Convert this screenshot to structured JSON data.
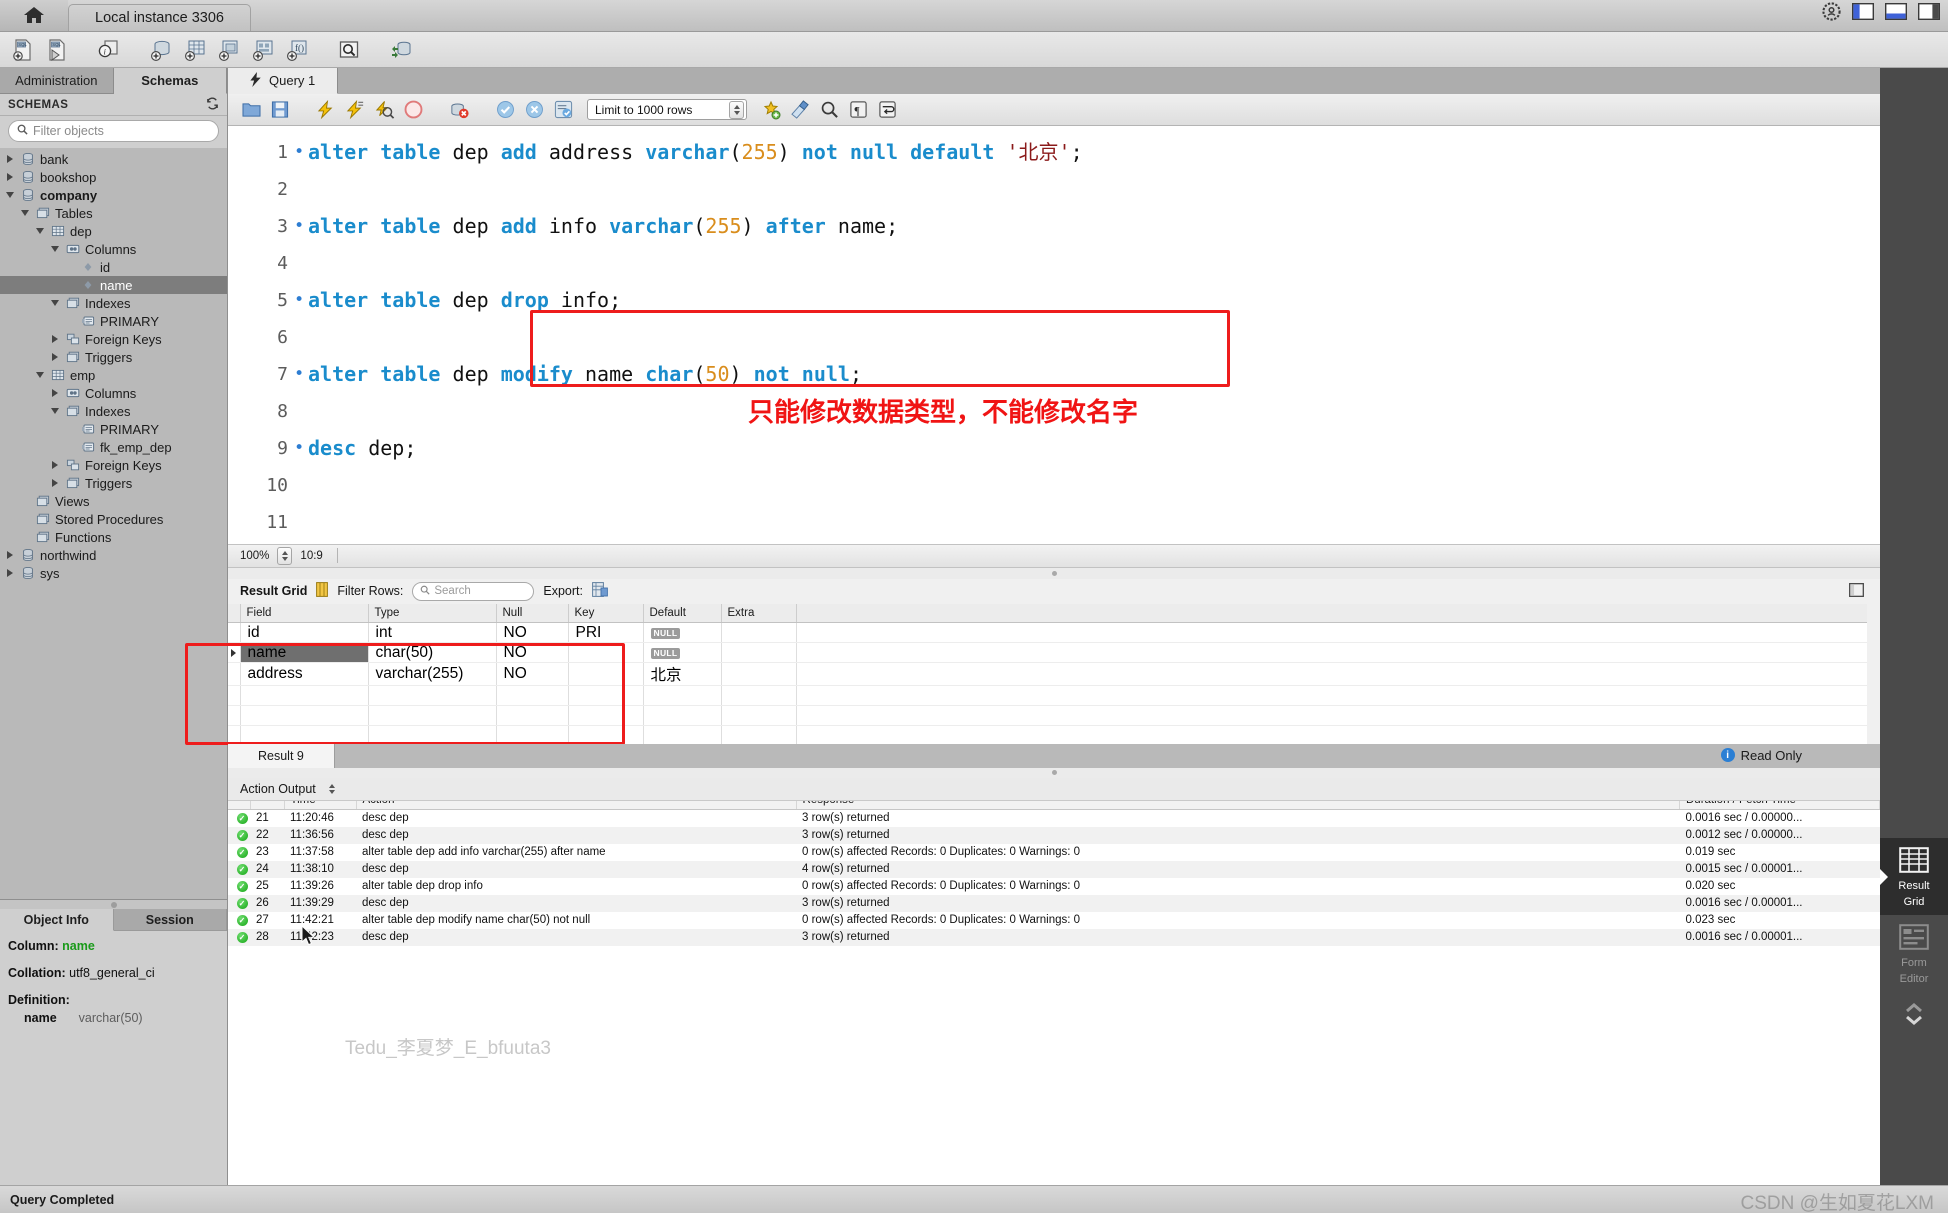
{
  "window": {
    "instance_tab": "Local instance 3306",
    "home_icon": "home-icon"
  },
  "top_right_icons": [
    "shield-gear-icon",
    "toggle-sidebar-icon",
    "toggle-output-icon",
    "toggle-secondary-sidebar-icon"
  ],
  "main_toolbar_icons": [
    "new-sql-tab-icon",
    "open-sql-script-icon",
    "sql-info-icon",
    "new-schema-icon",
    "new-table-icon",
    "new-view-icon",
    "new-stored-procedure-icon",
    "new-function-icon",
    "inspect-table-icon",
    "reconnect-server-icon"
  ],
  "sidebar": {
    "tabs": [
      {
        "label": "Administration",
        "active": false
      },
      {
        "label": "Schemas",
        "active": true
      }
    ],
    "schemas_header": "SCHEMAS",
    "refresh_icon": "refresh-icon",
    "filter": {
      "placeholder": "Filter objects",
      "value": "",
      "icon": "search-icon"
    },
    "tree": [
      {
        "label": "bank",
        "depth": 0,
        "state": "collapsed",
        "icon": "database-icon",
        "selected": false,
        "bold": false
      },
      {
        "label": "bookshop",
        "depth": 0,
        "state": "collapsed",
        "icon": "database-icon",
        "selected": false,
        "bold": false
      },
      {
        "label": "company",
        "depth": 0,
        "state": "expanded",
        "icon": "database-icon",
        "selected": false,
        "bold": true
      },
      {
        "label": "Tables",
        "depth": 1,
        "state": "expanded",
        "icon": "folder-icon",
        "selected": false,
        "bold": false
      },
      {
        "label": "dep",
        "depth": 2,
        "state": "expanded",
        "icon": "table-icon",
        "selected": false,
        "bold": false
      },
      {
        "label": "Columns",
        "depth": 3,
        "state": "expanded",
        "icon": "columns-icon",
        "selected": false,
        "bold": false
      },
      {
        "label": "id",
        "depth": 4,
        "state": "leaf",
        "icon": "column-icon",
        "selected": false,
        "bold": false
      },
      {
        "label": "name",
        "depth": 4,
        "state": "leaf",
        "icon": "column-icon",
        "selected": true,
        "bold": false
      },
      {
        "label": "Indexes",
        "depth": 3,
        "state": "expanded",
        "icon": "folder-icon",
        "selected": false,
        "bold": false
      },
      {
        "label": "PRIMARY",
        "depth": 4,
        "state": "leaf",
        "icon": "index-icon",
        "selected": false,
        "bold": false
      },
      {
        "label": "Foreign Keys",
        "depth": 3,
        "state": "collapsed",
        "icon": "fk-icon",
        "selected": false,
        "bold": false
      },
      {
        "label": "Triggers",
        "depth": 3,
        "state": "collapsed",
        "icon": "folder-icon",
        "selected": false,
        "bold": false
      },
      {
        "label": "emp",
        "depth": 2,
        "state": "expanded",
        "icon": "table-icon",
        "selected": false,
        "bold": false
      },
      {
        "label": "Columns",
        "depth": 3,
        "state": "collapsed",
        "icon": "columns-icon",
        "selected": false,
        "bold": false
      },
      {
        "label": "Indexes",
        "depth": 3,
        "state": "expanded",
        "icon": "folder-icon",
        "selected": false,
        "bold": false
      },
      {
        "label": "PRIMARY",
        "depth": 4,
        "state": "leaf",
        "icon": "index-icon",
        "selected": false,
        "bold": false
      },
      {
        "label": "fk_emp_dep",
        "depth": 4,
        "state": "leaf",
        "icon": "index-icon",
        "selected": false,
        "bold": false
      },
      {
        "label": "Foreign Keys",
        "depth": 3,
        "state": "collapsed",
        "icon": "fk-icon",
        "selected": false,
        "bold": false
      },
      {
        "label": "Triggers",
        "depth": 3,
        "state": "collapsed",
        "icon": "folder-icon",
        "selected": false,
        "bold": false
      },
      {
        "label": "Views",
        "depth": 1,
        "state": "leaf",
        "icon": "folder-icon",
        "selected": false,
        "bold": false
      },
      {
        "label": "Stored Procedures",
        "depth": 1,
        "state": "leaf",
        "icon": "folder-icon",
        "selected": false,
        "bold": false
      },
      {
        "label": "Functions",
        "depth": 1,
        "state": "leaf",
        "icon": "folder-icon",
        "selected": false,
        "bold": false
      },
      {
        "label": "northwind",
        "depth": 0,
        "state": "collapsed",
        "icon": "database-icon",
        "selected": false,
        "bold": false
      },
      {
        "label": "sys",
        "depth": 0,
        "state": "collapsed",
        "icon": "database-icon",
        "selected": false,
        "bold": false
      }
    ]
  },
  "object_info": {
    "tabs": [
      {
        "label": "Object Info",
        "active": true
      },
      {
        "label": "Session",
        "active": false
      }
    ],
    "column_key": "Column:",
    "column_value": "name",
    "collation_key": "Collation:",
    "collation_value": "utf8_general_ci",
    "definition_key": "Definition:",
    "definition_name": "name",
    "definition_type": "varchar(50)"
  },
  "query_tab": {
    "label": "Query 1",
    "icon": "lightning-icon"
  },
  "query_toolbar": {
    "icons": [
      "open-file-icon",
      "save-file-icon",
      "execute-icon",
      "execute-current-icon",
      "explain-icon",
      "stop-icon",
      "stop-on-error-icon",
      "commit-icon",
      "rollback-icon",
      "autocommit-icon"
    ],
    "limit_select": "Limit to 1000 rows",
    "trailing_icons": [
      "beautify-icon",
      "clear-context-icon",
      "find-icon",
      "invisible-chars-icon",
      "wrap-lines-icon"
    ]
  },
  "editor": {
    "lines": [
      {
        "n": "1",
        "bullet": true,
        "tokens": [
          {
            "t": "kw",
            "v": "alter"
          },
          {
            "t": "pln",
            "v": " "
          },
          {
            "t": "kw",
            "v": "table"
          },
          {
            "t": "pln",
            "v": " dep "
          },
          {
            "t": "kw",
            "v": "add"
          },
          {
            "t": "pln",
            "v": " address "
          },
          {
            "t": "kw",
            "v": "varchar"
          },
          {
            "t": "pln",
            "v": "("
          },
          {
            "t": "num",
            "v": "255"
          },
          {
            "t": "pln",
            "v": ") "
          },
          {
            "t": "kw",
            "v": "not null default"
          },
          {
            "t": "pln",
            "v": " "
          },
          {
            "t": "str",
            "v": "'北京'"
          },
          {
            "t": "pln",
            "v": ";"
          }
        ]
      },
      {
        "n": "2",
        "bullet": false,
        "tokens": []
      },
      {
        "n": "3",
        "bullet": true,
        "tokens": [
          {
            "t": "kw",
            "v": "alter"
          },
          {
            "t": "pln",
            "v": " "
          },
          {
            "t": "kw",
            "v": "table"
          },
          {
            "t": "pln",
            "v": " dep "
          },
          {
            "t": "kw",
            "v": "add"
          },
          {
            "t": "pln",
            "v": " info "
          },
          {
            "t": "kw",
            "v": "varchar"
          },
          {
            "t": "pln",
            "v": "("
          },
          {
            "t": "num",
            "v": "255"
          },
          {
            "t": "pln",
            "v": ") "
          },
          {
            "t": "kw",
            "v": "after"
          },
          {
            "t": "pln",
            "v": " name;"
          }
        ]
      },
      {
        "n": "4",
        "bullet": false,
        "tokens": []
      },
      {
        "n": "5",
        "bullet": true,
        "tokens": [
          {
            "t": "kw",
            "v": "alter"
          },
          {
            "t": "pln",
            "v": " "
          },
          {
            "t": "kw",
            "v": "table"
          },
          {
            "t": "pln",
            "v": " dep "
          },
          {
            "t": "kw",
            "v": "drop"
          },
          {
            "t": "pln",
            "v": " info;"
          }
        ]
      },
      {
        "n": "6",
        "bullet": false,
        "tokens": []
      },
      {
        "n": "7",
        "bullet": true,
        "tokens": [
          {
            "t": "kw",
            "v": "alter"
          },
          {
            "t": "pln",
            "v": " "
          },
          {
            "t": "kw",
            "v": "table"
          },
          {
            "t": "pln",
            "v": " dep "
          },
          {
            "t": "kw",
            "v": "modify"
          },
          {
            "t": "pln",
            "v": " name "
          },
          {
            "t": "kw",
            "v": "char"
          },
          {
            "t": "pln",
            "v": "("
          },
          {
            "t": "num",
            "v": "50"
          },
          {
            "t": "pln",
            "v": ") "
          },
          {
            "t": "kw",
            "v": "not null"
          },
          {
            "t": "pln",
            "v": ";"
          }
        ]
      },
      {
        "n": "8",
        "bullet": false,
        "tokens": []
      },
      {
        "n": "9",
        "bullet": true,
        "tokens": [
          {
            "t": "kw",
            "v": "desc"
          },
          {
            "t": "pln",
            "v": " dep;"
          }
        ]
      },
      {
        "n": "10",
        "bullet": false,
        "tokens": []
      },
      {
        "n": "11",
        "bullet": false,
        "tokens": []
      }
    ],
    "annotation": "只能修改数据类型，不能修改名字",
    "annotation_color": "#f01414",
    "highlight_color": "#ee1c1c",
    "play_overlay": "play-icon"
  },
  "zoom_bar": {
    "zoom": "100%",
    "ratio": "10:9"
  },
  "result_panel": {
    "title": "Result Grid",
    "grid_icon": "grid-toggle-icon",
    "filter_label": "Filter Rows:",
    "search_placeholder": "Search",
    "search_value": "",
    "export_label": "Export:",
    "export_icon": "export-icon",
    "columns": [
      "Field",
      "Type",
      "Null",
      "Key",
      "Default",
      "Extra"
    ],
    "rows": [
      {
        "Field": "id",
        "Type": "int",
        "Null": "NO",
        "Key": "PRI",
        "Default": "NULL",
        "Extra": "",
        "default_is_null": true,
        "selected": false
      },
      {
        "Field": "name",
        "Type": "char(50)",
        "Null": "NO",
        "Key": "",
        "Default": "NULL",
        "Extra": "",
        "default_is_null": true,
        "selected": true
      },
      {
        "Field": "address",
        "Type": "varchar(255)",
        "Null": "NO",
        "Key": "",
        "Default": "北京",
        "Extra": "",
        "default_is_null": false,
        "selected": false
      }
    ],
    "result_tab": "Result 9",
    "read_only": "Read Only"
  },
  "action_output": {
    "label": "Action Output",
    "columns": [
      "",
      "",
      "Time",
      "Action",
      "Response",
      "Duration / Fetch Time"
    ],
    "rows": [
      {
        "num": "21",
        "time": "11:20:46",
        "action": "desc dep",
        "response": "3 row(s) returned",
        "duration": "0.0016 sec / 0.00000..."
      },
      {
        "num": "22",
        "time": "11:36:56",
        "action": "desc dep",
        "response": "3 row(s) returned",
        "duration": "0.0012 sec / 0.00000..."
      },
      {
        "num": "23",
        "time": "11:37:58",
        "action": "alter table dep add info varchar(255) after name",
        "response": "0 row(s) affected Records: 0  Duplicates: 0  Warnings: 0",
        "duration": "0.019 sec"
      },
      {
        "num": "24",
        "time": "11:38:10",
        "action": "desc dep",
        "response": "4 row(s) returned",
        "duration": "0.0015 sec / 0.00001..."
      },
      {
        "num": "25",
        "time": "11:39:26",
        "action": "alter table dep drop info",
        "response": "0 row(s) affected Records: 0  Duplicates: 0  Warnings: 0",
        "duration": "0.020 sec"
      },
      {
        "num": "26",
        "time": "11:39:29",
        "action": "desc dep",
        "response": "3 row(s) returned",
        "duration": "0.0016 sec / 0.00001..."
      },
      {
        "num": "27",
        "time": "11:42:21",
        "action": "alter table dep modify name char(50) not null",
        "response": "0 row(s) affected Records: 0  Duplicates: 0  Warnings: 0",
        "duration": "0.023 sec"
      },
      {
        "num": "28",
        "time": "11:42:23",
        "action": "desc dep",
        "response": "3 row(s) returned",
        "duration": "0.0016 sec / 0.00001..."
      }
    ]
  },
  "right_toolbar": [
    {
      "label": "Result\nGrid",
      "label_line1": "Result",
      "label_line2": "Grid",
      "icon": "result-grid-icon",
      "active": true
    },
    {
      "label": "Form\nEditor",
      "label_line1": "Form",
      "label_line2": "Editor",
      "icon": "form-editor-icon",
      "active": false
    }
  ],
  "status_bar": {
    "text": "Query Completed"
  },
  "watermarks": {
    "csdn": "CSDN @生如夏花LXM",
    "tedu": "Tedu_李夏梦_E_bfuuta3"
  }
}
